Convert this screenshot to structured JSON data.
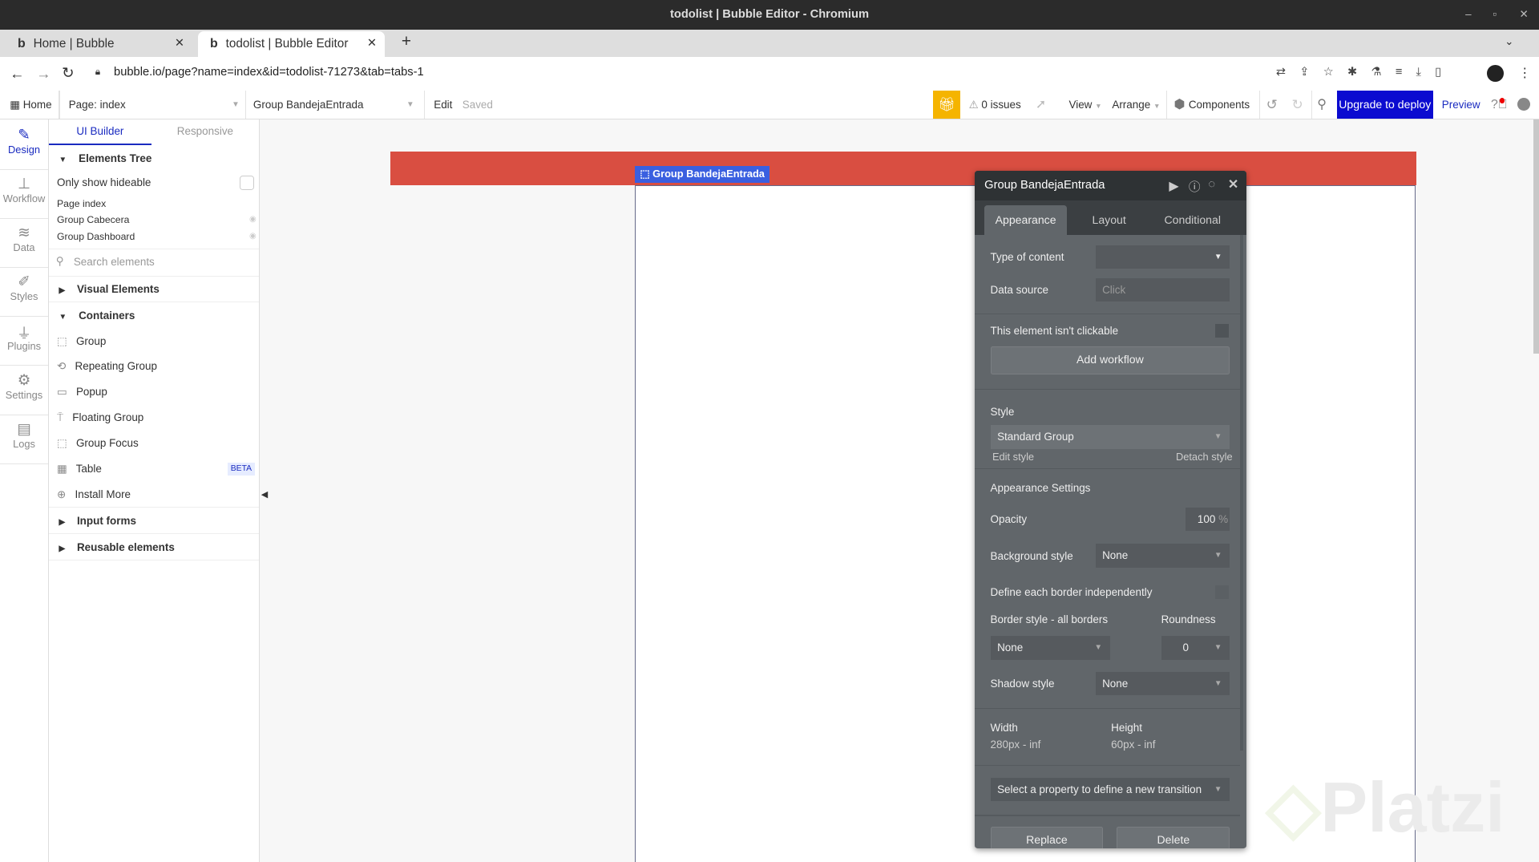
{
  "window": {
    "title": "todolist | Bubble Editor - Chromium"
  },
  "browser": {
    "tabs": [
      {
        "label": "Home | Bubble"
      },
      {
        "label": "todolist | Bubble Editor"
      }
    ],
    "url": "bubble.io/page?name=index&id=todolist-71273&tab=tabs-1"
  },
  "toolbar": {
    "home": "Home",
    "page": "Page: index",
    "element": "Group BandejaEntrada",
    "edit": "Edit",
    "saved": "Saved",
    "issues": "0 issues",
    "view": "View",
    "arrange": "Arrange",
    "components": "Components",
    "upgrade": "Upgrade to deploy",
    "preview": "Preview"
  },
  "nav": [
    {
      "label": "Design"
    },
    {
      "label": "Workflow"
    },
    {
      "label": "Data"
    },
    {
      "label": "Styles"
    },
    {
      "label": "Plugins"
    },
    {
      "label": "Settings"
    },
    {
      "label": "Logs"
    }
  ],
  "side": {
    "tabs": [
      "UI Builder",
      "Responsive"
    ],
    "tree_title": "Elements Tree",
    "only_hideable": "Only show hideable",
    "tree": [
      "Page index",
      "Group Cabecera",
      "Group Dashboard"
    ],
    "search_placeholder": "Search elements",
    "visual": "Visual Elements",
    "containers": "Containers",
    "items": [
      "Group",
      "Repeating Group",
      "Popup",
      "Floating Group",
      "Group Focus",
      "Table",
      "Install More"
    ],
    "beta": "BETA",
    "input_forms": "Input forms",
    "reusable": "Reusable elements"
  },
  "canvas": {
    "selected_label": "Group BandejaEntrada",
    "header_color": "#d94e41"
  },
  "panel": {
    "title": "Group BandejaEntrada",
    "tabs": [
      "Appearance",
      "Layout",
      "Conditional"
    ],
    "type_of_content": "Type of content",
    "data_source": "Data source",
    "data_source_placeholder": "Click",
    "not_clickable": "This element isn't clickable",
    "add_workflow": "Add workflow",
    "style": "Style",
    "style_value": "Standard Group",
    "edit_style": "Edit style",
    "detach_style": "Detach style",
    "appearance_settings": "Appearance Settings",
    "opacity": "Opacity",
    "opacity_value": "100",
    "opacity_unit": "%",
    "background_style": "Background style",
    "background_value": "None",
    "border_indep": "Define each border independently",
    "border_style": "Border style - all borders",
    "roundness": "Roundness",
    "border_value": "None",
    "roundness_value": "0",
    "shadow_style": "Shadow style",
    "shadow_value": "None",
    "width": "Width",
    "width_value": "280px - inf",
    "height": "Height",
    "height_value": "60px - inf",
    "transition": "Select a property to define a new transition",
    "replace": "Replace",
    "delete": "Delete"
  },
  "watermark": "Platzi"
}
